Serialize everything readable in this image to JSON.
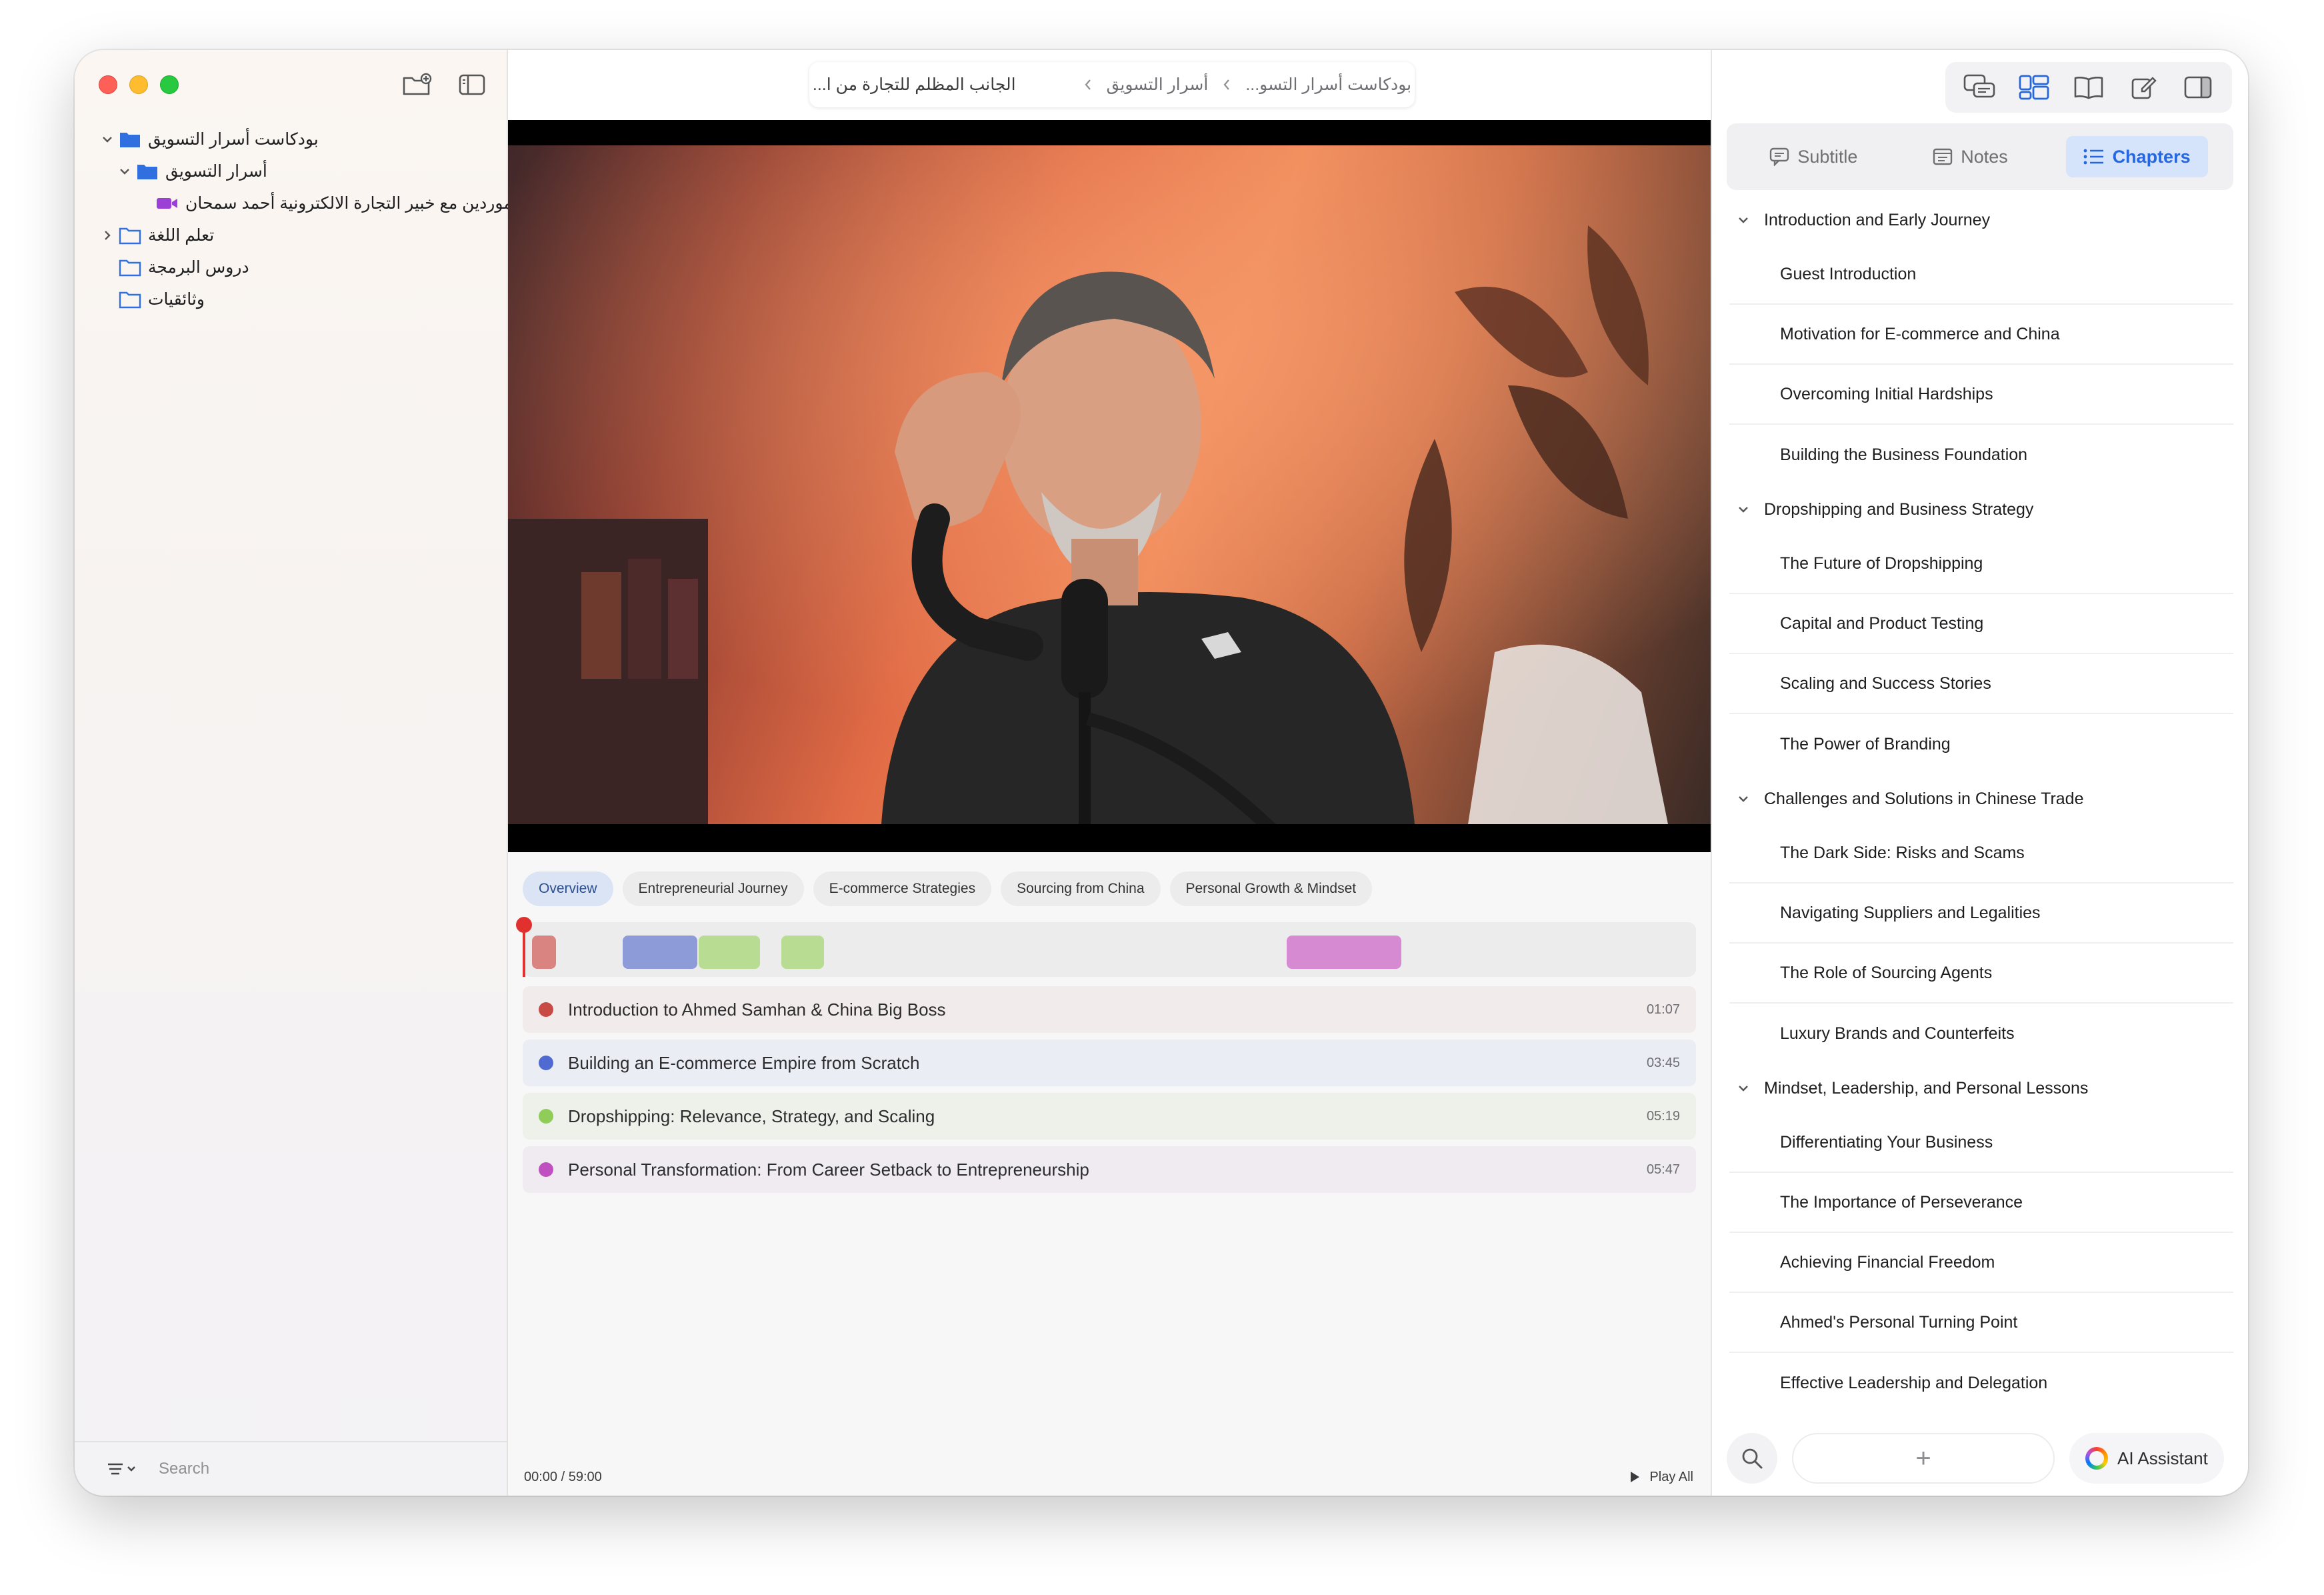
{
  "sidebar": {
    "tree": [
      {
        "label": "بودكاست أسرار التسويق",
        "expanded": true,
        "type": "folder-filled"
      },
      {
        "label": "أسرار التسويق",
        "expanded": true,
        "type": "folder-filled"
      },
      {
        "label": "الجانب المظلم للتجارة من الصين: الموردين مع خبير التجارة الالكترونية أحمد سمحان",
        "type": "video"
      },
      {
        "label": "تعلم اللغة",
        "expanded": false,
        "type": "folder-outline"
      },
      {
        "label": "دروس البرمجة",
        "type": "folder-outline"
      },
      {
        "label": "وثائقيات",
        "type": "folder-outline"
      }
    ],
    "search_placeholder": "Search"
  },
  "breadcrumb": {
    "items": [
      "بودكاست أسرار التسو...",
      "أسرار التسويق",
      "الجانب المظلم للتجارة من ا..."
    ]
  },
  "tabs": [
    "Overview",
    "Entrepreneurial Journey",
    "E-commerce Strategies",
    "Sourcing from China",
    "Personal Growth & Mindset"
  ],
  "colors": {
    "red": "#c84a45",
    "blue": "#5470c6",
    "green": "#8fcc58",
    "purple": "#c04fc0"
  },
  "chapters": [
    {
      "title": "Introduction to Ahmed Samhan & China Big Boss",
      "time": "01:07",
      "color": "#c84a45",
      "bg": "#f1ebeb"
    },
    {
      "title": "Building an E-commerce Empire from Scratch",
      "time": "03:45",
      "color": "#4f6ad1",
      "bg": "#ebedf4"
    },
    {
      "title": "Dropshipping: Relevance, Strategy, and Scaling",
      "time": "05:19",
      "color": "#8fcc58",
      "bg": "#eef1ea"
    },
    {
      "title": "Personal Transformation: From Career Setback to Entrepreneurship",
      "time": "05:47",
      "color": "#c04fc0",
      "bg": "#efebf1"
    }
  ],
  "playback": {
    "time": "00:00 / 59:00",
    "play_all": "Play All"
  },
  "right": {
    "tabs": [
      "Subtitle",
      "Notes",
      "Chapters"
    ],
    "outline": [
      {
        "title": "Introduction and Early Journey",
        "items": [
          "Guest Introduction",
          "Motivation for E-commerce and China",
          "Overcoming Initial Hardships",
          "Building the Business Foundation"
        ]
      },
      {
        "title": "Dropshipping and Business Strategy",
        "items": [
          "The Future of Dropshipping",
          "Capital and Product Testing",
          "Scaling and Success Stories",
          "The Power of Branding"
        ]
      },
      {
        "title": "Challenges and Solutions in Chinese Trade",
        "items": [
          "The Dark Side: Risks and Scams",
          "Navigating Suppliers and Legalities",
          "The Role of Sourcing Agents",
          "Luxury Brands and Counterfeits"
        ]
      },
      {
        "title": "Mindset, Leadership, and Personal Lessons",
        "items": [
          "Differentiating Your Business",
          "The Importance of Perseverance",
          "Achieving Financial Freedom",
          "Ahmed's Personal Turning Point",
          "Effective Leadership and Delegation"
        ]
      }
    ],
    "add_symbol": "+",
    "ai_label": "AI Assistant"
  }
}
